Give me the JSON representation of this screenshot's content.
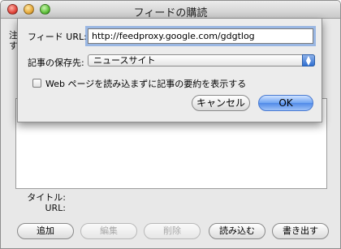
{
  "window": {
    "title": "フィードの購読",
    "behind_text": "注\nす"
  },
  "info": {
    "title_label": "タイトル:",
    "url_label": "URL:"
  },
  "buttons": {
    "add": "追加",
    "edit": "編集",
    "delete": "削除",
    "load": "読み込む",
    "export": "書き出す"
  },
  "sheet": {
    "feed_url_label": "フィード URL:",
    "feed_url_value": "http://feedproxy.google.com/gdgtlog",
    "folder_label": "記事の保存先:",
    "folder_value": "ニュースサイト",
    "summary_checkbox_label": "Web ページを読み込まずに記事の要約を表示する",
    "summary_checked": false,
    "cancel": "キャンセル",
    "ok": "OK"
  },
  "colors": {
    "accent": "#4f8ae8",
    "focus_ring": "#588cdc"
  }
}
